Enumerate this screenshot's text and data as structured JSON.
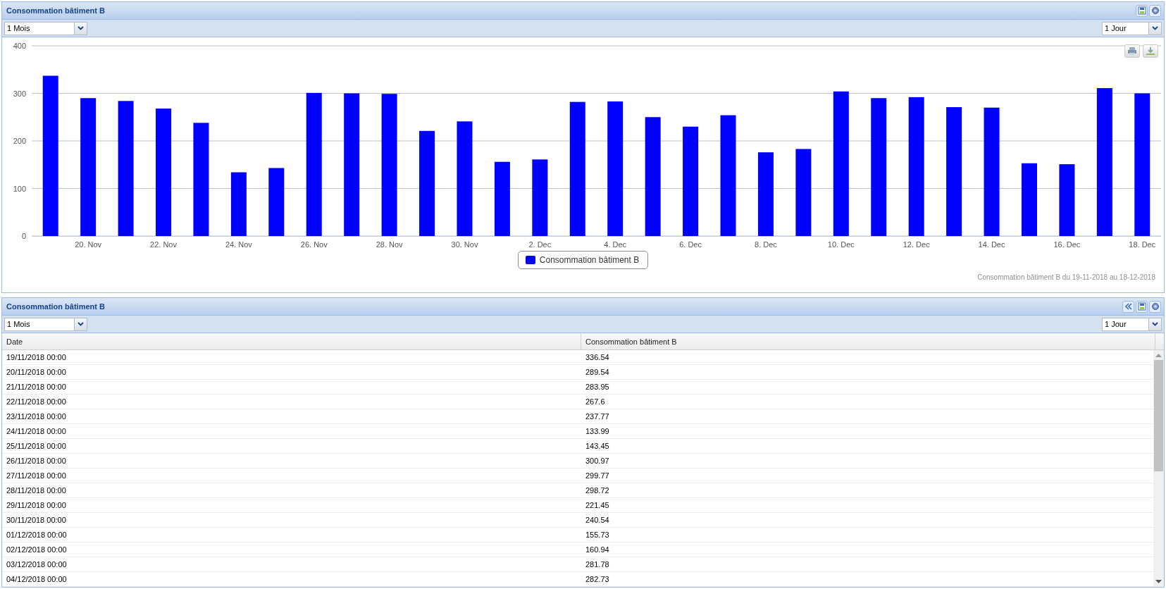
{
  "chart_panel": {
    "title": "Consommation bâtiment B",
    "period": "1 Mois",
    "step": "1 Jour",
    "chart_data": {
      "type": "bar",
      "ylim": [
        0,
        400
      ],
      "yticks": [
        0,
        100,
        200,
        300,
        400
      ],
      "grid": true,
      "categories": [
        null,
        "20. Nov",
        null,
        "22. Nov",
        null,
        "24. Nov",
        null,
        "26. Nov",
        null,
        "28. Nov",
        null,
        "30. Nov",
        null,
        "2. Dec",
        null,
        "4. Dec",
        null,
        "6. Dec",
        null,
        "8. Dec",
        null,
        "10. Dec",
        null,
        "12. Dec",
        null,
        "14. Dec",
        null,
        "16. Dec",
        null,
        "18. Dec"
      ],
      "series": [
        {
          "name": "Consommation bâtiment B",
          "color": "#0000ff",
          "values": [
            337,
            290,
            284,
            268,
            238,
            134,
            143,
            301,
            300,
            299,
            221,
            241,
            156,
            161,
            282,
            283,
            250,
            230,
            254,
            176,
            183,
            304,
            290,
            292,
            271,
            270,
            153,
            151,
            311,
            300
          ]
        }
      ]
    },
    "caption": "Consommation bâtiment B du 19-11-2018 au 18-12-2018"
  },
  "table_panel": {
    "title": "Consommation bâtiment B",
    "period": "1 Mois",
    "step": "1 Jour",
    "columns": [
      "Date",
      "Consommation bâtiment B"
    ],
    "rows": [
      [
        "19/11/2018 00:00",
        "336.54"
      ],
      [
        "20/11/2018 00:00",
        "289.54"
      ],
      [
        "21/11/2018 00:00",
        "283.95"
      ],
      [
        "22/11/2018 00:00",
        "267.6"
      ],
      [
        "23/11/2018 00:00",
        "237.77"
      ],
      [
        "24/11/2018 00:00",
        "133.99"
      ],
      [
        "25/11/2018 00:00",
        "143.45"
      ],
      [
        "26/11/2018 00:00",
        "300.97"
      ],
      [
        "27/11/2018 00:00",
        "299.77"
      ],
      [
        "28/11/2018 00:00",
        "298.72"
      ],
      [
        "29/11/2018 00:00",
        "221.45"
      ],
      [
        "30/11/2018 00:00",
        "240.54"
      ],
      [
        "01/12/2018 00:00",
        "155.73"
      ],
      [
        "02/12/2018 00:00",
        "160.94"
      ],
      [
        "03/12/2018 00:00",
        "281.78"
      ],
      [
        "04/12/2018 00:00",
        "282.73"
      ]
    ]
  }
}
